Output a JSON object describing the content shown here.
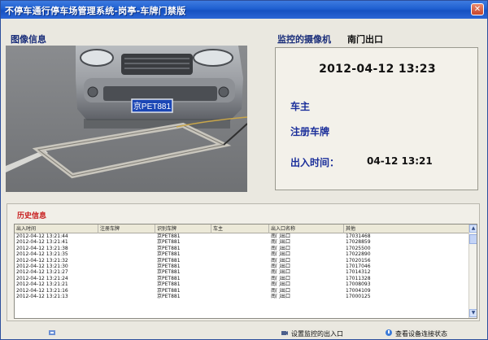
{
  "window": {
    "title": "不停车通行停车场管理系统-岗亭-车牌门禁版",
    "close_icon": "close-icon"
  },
  "sections": {
    "image_info": "图像信息",
    "monitor_camera": "监控的摄像机",
    "camera_name": "南门出口",
    "history": "历史信息"
  },
  "plate_on_car": "京PET881",
  "info": {
    "datetime": "2012-04-12 13:23",
    "owner_label": "车主",
    "plate_label": "注册车牌",
    "inout_label": "出入时间：",
    "inout_time": "04-12 13:21"
  },
  "table": {
    "columns": [
      "出入时间",
      "注册车牌",
      "识别车牌",
      "车主",
      "出入口名称",
      "其他"
    ],
    "rows": [
      [
        "2012-04-12 13:21:44",
        "",
        "京PET881",
        "",
        "南门出口",
        "17031468"
      ],
      [
        "2012-04-12 13:21:41",
        "",
        "京PET881",
        "",
        "南门出口",
        "17028859"
      ],
      [
        "2012-04-12 13:21:38",
        "",
        "京PET881",
        "",
        "南门出口",
        "17025500"
      ],
      [
        "2012-04-12 13:21:35",
        "",
        "京PET881",
        "",
        "南门出口",
        "17022890"
      ],
      [
        "2012-04-12 13:21:32",
        "",
        "京PET881",
        "",
        "南门出口",
        "17020156"
      ],
      [
        "2012-04-12 13:21:30",
        "",
        "京PET881",
        "",
        "南门出口",
        "17017046"
      ],
      [
        "2012-04-12 13:21:27",
        "",
        "京PET881",
        "",
        "南门出口",
        "17014312"
      ],
      [
        "2012-04-12 13:21:24",
        "",
        "京PET881",
        "",
        "南门出口",
        "17011328"
      ],
      [
        "2012-04-12 13:21:21",
        "",
        "京PET881",
        "",
        "南门出口",
        "17008093"
      ],
      [
        "2012-04-12 13:21:16",
        "",
        "京PET881",
        "",
        "南门出口",
        "17004109"
      ],
      [
        "2012-04-12 13:21:13",
        "",
        "京PET881",
        "",
        "南门出口",
        "17000125"
      ]
    ]
  },
  "toolbar": {
    "set_camera": "设置监控的出入口",
    "view_status": "查看设备连接状态"
  },
  "colors": {
    "title_bar": "#1f5fd0",
    "label_blue": "#1a2e9a",
    "history_red": "#c82020"
  }
}
